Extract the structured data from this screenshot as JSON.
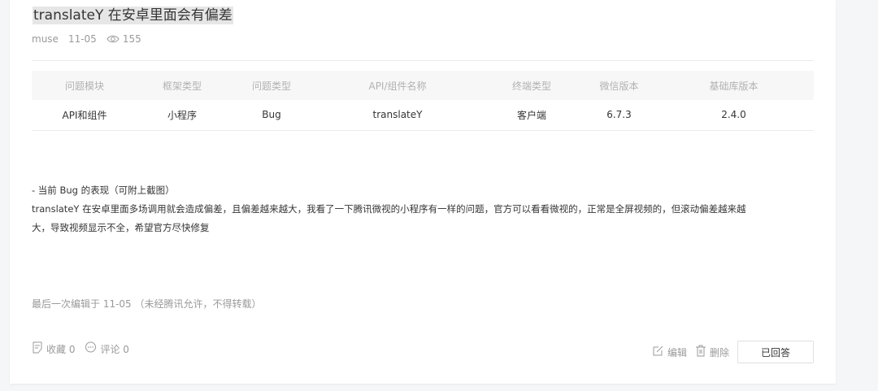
{
  "post": {
    "title": "translateY 在安卓里面会有偏差",
    "author": "muse",
    "date": "11-05",
    "views": "155"
  },
  "table": {
    "headers": [
      "问题模块",
      "框架类型",
      "问题类型",
      "API/组件名称",
      "终端类型",
      "微信版本",
      "基础库版本"
    ],
    "row": [
      "API和组件",
      "小程序",
      "Bug",
      "translateY",
      "客户端",
      "6.7.3",
      "2.4.0"
    ]
  },
  "content": {
    "line1": "- 当前 Bug 的表现（可附上截图）",
    "line2": "translateY 在安卓里面多场调用就会造成偏差，且偏差越来越大，我看了一下腾讯微视的小程序有一样的问题，官方可以看看微视的，正常是全屏视频的，但滚动偏差越来越",
    "line3": "大，导致视频显示不全，希望官方尽快修复"
  },
  "edit_note": "最后一次编辑于  11-05  （未经腾讯允许，不得转载）",
  "actions": {
    "favorite": "收藏 0",
    "comment": "评论 0",
    "edit": "编辑",
    "delete": "删除",
    "answered": "已回答"
  },
  "icons": [
    "eye-icon",
    "favorite-icon",
    "comment-icon",
    "edit-icon",
    "delete-icon"
  ]
}
